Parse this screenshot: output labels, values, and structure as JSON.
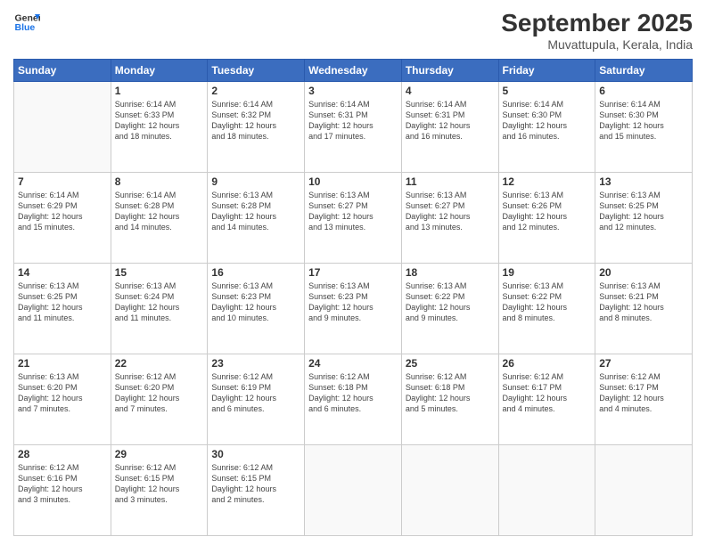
{
  "header": {
    "logo_line1": "General",
    "logo_line2": "Blue",
    "month_title": "September 2025",
    "location": "Muvattupula, Kerala, India"
  },
  "days_of_week": [
    "Sunday",
    "Monday",
    "Tuesday",
    "Wednesday",
    "Thursday",
    "Friday",
    "Saturday"
  ],
  "weeks": [
    [
      {
        "day": "",
        "info": ""
      },
      {
        "day": "1",
        "info": "Sunrise: 6:14 AM\nSunset: 6:33 PM\nDaylight: 12 hours\nand 18 minutes."
      },
      {
        "day": "2",
        "info": "Sunrise: 6:14 AM\nSunset: 6:32 PM\nDaylight: 12 hours\nand 18 minutes."
      },
      {
        "day": "3",
        "info": "Sunrise: 6:14 AM\nSunset: 6:31 PM\nDaylight: 12 hours\nand 17 minutes."
      },
      {
        "day": "4",
        "info": "Sunrise: 6:14 AM\nSunset: 6:31 PM\nDaylight: 12 hours\nand 16 minutes."
      },
      {
        "day": "5",
        "info": "Sunrise: 6:14 AM\nSunset: 6:30 PM\nDaylight: 12 hours\nand 16 minutes."
      },
      {
        "day": "6",
        "info": "Sunrise: 6:14 AM\nSunset: 6:30 PM\nDaylight: 12 hours\nand 15 minutes."
      }
    ],
    [
      {
        "day": "7",
        "info": "Sunrise: 6:14 AM\nSunset: 6:29 PM\nDaylight: 12 hours\nand 15 minutes."
      },
      {
        "day": "8",
        "info": "Sunrise: 6:14 AM\nSunset: 6:28 PM\nDaylight: 12 hours\nand 14 minutes."
      },
      {
        "day": "9",
        "info": "Sunrise: 6:13 AM\nSunset: 6:28 PM\nDaylight: 12 hours\nand 14 minutes."
      },
      {
        "day": "10",
        "info": "Sunrise: 6:13 AM\nSunset: 6:27 PM\nDaylight: 12 hours\nand 13 minutes."
      },
      {
        "day": "11",
        "info": "Sunrise: 6:13 AM\nSunset: 6:27 PM\nDaylight: 12 hours\nand 13 minutes."
      },
      {
        "day": "12",
        "info": "Sunrise: 6:13 AM\nSunset: 6:26 PM\nDaylight: 12 hours\nand 12 minutes."
      },
      {
        "day": "13",
        "info": "Sunrise: 6:13 AM\nSunset: 6:25 PM\nDaylight: 12 hours\nand 12 minutes."
      }
    ],
    [
      {
        "day": "14",
        "info": "Sunrise: 6:13 AM\nSunset: 6:25 PM\nDaylight: 12 hours\nand 11 minutes."
      },
      {
        "day": "15",
        "info": "Sunrise: 6:13 AM\nSunset: 6:24 PM\nDaylight: 12 hours\nand 11 minutes."
      },
      {
        "day": "16",
        "info": "Sunrise: 6:13 AM\nSunset: 6:23 PM\nDaylight: 12 hours\nand 10 minutes."
      },
      {
        "day": "17",
        "info": "Sunrise: 6:13 AM\nSunset: 6:23 PM\nDaylight: 12 hours\nand 9 minutes."
      },
      {
        "day": "18",
        "info": "Sunrise: 6:13 AM\nSunset: 6:22 PM\nDaylight: 12 hours\nand 9 minutes."
      },
      {
        "day": "19",
        "info": "Sunrise: 6:13 AM\nSunset: 6:22 PM\nDaylight: 12 hours\nand 8 minutes."
      },
      {
        "day": "20",
        "info": "Sunrise: 6:13 AM\nSunset: 6:21 PM\nDaylight: 12 hours\nand 8 minutes."
      }
    ],
    [
      {
        "day": "21",
        "info": "Sunrise: 6:13 AM\nSunset: 6:20 PM\nDaylight: 12 hours\nand 7 minutes."
      },
      {
        "day": "22",
        "info": "Sunrise: 6:12 AM\nSunset: 6:20 PM\nDaylight: 12 hours\nand 7 minutes."
      },
      {
        "day": "23",
        "info": "Sunrise: 6:12 AM\nSunset: 6:19 PM\nDaylight: 12 hours\nand 6 minutes."
      },
      {
        "day": "24",
        "info": "Sunrise: 6:12 AM\nSunset: 6:18 PM\nDaylight: 12 hours\nand 6 minutes."
      },
      {
        "day": "25",
        "info": "Sunrise: 6:12 AM\nSunset: 6:18 PM\nDaylight: 12 hours\nand 5 minutes."
      },
      {
        "day": "26",
        "info": "Sunrise: 6:12 AM\nSunset: 6:17 PM\nDaylight: 12 hours\nand 4 minutes."
      },
      {
        "day": "27",
        "info": "Sunrise: 6:12 AM\nSunset: 6:17 PM\nDaylight: 12 hours\nand 4 minutes."
      }
    ],
    [
      {
        "day": "28",
        "info": "Sunrise: 6:12 AM\nSunset: 6:16 PM\nDaylight: 12 hours\nand 3 minutes."
      },
      {
        "day": "29",
        "info": "Sunrise: 6:12 AM\nSunset: 6:15 PM\nDaylight: 12 hours\nand 3 minutes."
      },
      {
        "day": "30",
        "info": "Sunrise: 6:12 AM\nSunset: 6:15 PM\nDaylight: 12 hours\nand 2 minutes."
      },
      {
        "day": "",
        "info": ""
      },
      {
        "day": "",
        "info": ""
      },
      {
        "day": "",
        "info": ""
      },
      {
        "day": "",
        "info": ""
      }
    ]
  ]
}
